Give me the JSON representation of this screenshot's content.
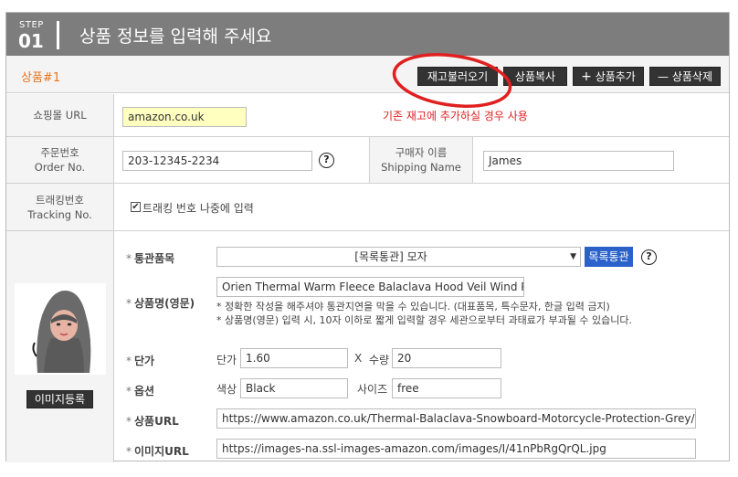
{
  "header": {
    "step_label": "STEP",
    "step_number": "01",
    "title": "상품 정보를 입력해 주세요"
  },
  "product": {
    "label": "상품#1"
  },
  "toolbar": {
    "load_stock": "재고불러오기",
    "copy": "상품복사",
    "add": "상품추가",
    "delete": "상품삭제",
    "add_glyph": "+",
    "delete_glyph": "—"
  },
  "annotation": {
    "text": "기존 재고에 추가하실 경우 사용",
    "color": "#e02020"
  },
  "shop_url": {
    "label": "쇼핑몰 URL",
    "value": "amazon.co.uk"
  },
  "order": {
    "label_ko": "주문번호",
    "label_en": "Order No.",
    "value": "203-12345-2234"
  },
  "shipping": {
    "label_ko": "구매자 이름",
    "label_en": "Shipping Name",
    "value": "James"
  },
  "tracking": {
    "label_ko": "트래킹번호",
    "label_en": "Tracking No.",
    "checkbox_label": "트래킹 번호 나중에 입력",
    "checked": true
  },
  "image": {
    "register_button": "이미지등록"
  },
  "customs": {
    "label": "통관품목",
    "selected": "[목록통관] 모자",
    "button": "목록통관"
  },
  "product_name": {
    "label": "상품명(영문)",
    "value": "Orien Thermal Warm Fleece Balaclava Hood Veil Wind Proo",
    "note1": "* 정확한 작성을 해주셔야 통관지연을 막을 수 있습니다. (대표품목, 특수문자, 한글 입력 금지)",
    "note2": "* 상품명(영문) 입력 시, 10자 이하로 짧게 입력할 경우 세관으로부터 과태료가 부과될 수 있습니다."
  },
  "price": {
    "label": "단가",
    "unit_label": "단가",
    "unit_value": "1.60",
    "x": "X",
    "qty_label": "수량",
    "qty_value": "20"
  },
  "option": {
    "label": "옵션",
    "color_label": "색상",
    "color_value": "Black",
    "size_label": "사이즈",
    "size_value": "free"
  },
  "product_url": {
    "label": "상품URL",
    "value": "https://www.amazon.co.uk/Thermal-Balaclava-Snowboard-Motorcycle-Protection-Grey/dp/B"
  },
  "image_url": {
    "label": "이미지URL",
    "value": "https://images-na.ssl-images-amazon.com/images/I/41nPbRgQrQL.jpg"
  },
  "help_glyph": "?",
  "star": "*",
  "select_arrow": "▼",
  "colors": {
    "accent_orange": "#e8741d",
    "header_gray": "#7d7d7d",
    "button_blue": "#2a62c9",
    "url_highlight": "#ffffc0"
  }
}
